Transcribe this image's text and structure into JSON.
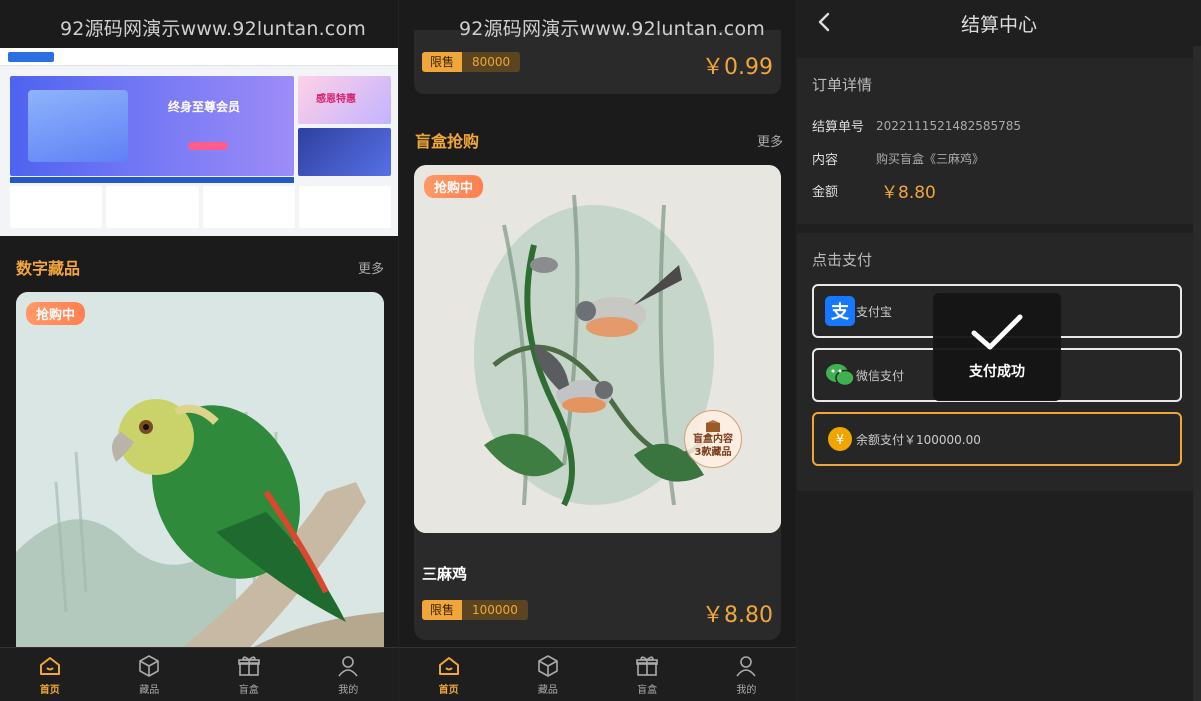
{
  "watermark": {
    "left": "92源码网演示www.92luntan.com",
    "middle": "92源码网演示www.92luntan.com"
  },
  "panel1": {
    "banner": {
      "hero_title": "终身至尊会员",
      "side_title": "感恩特惠"
    },
    "section": {
      "title": "数字藏品",
      "more": "更多"
    },
    "card": {
      "tag": "抢购中"
    }
  },
  "panel2": {
    "top_item": {
      "badge_label": "限售",
      "badge_count": "80000",
      "price": "￥0.99"
    },
    "section": {
      "title": "盲盒抢购",
      "more": "更多"
    },
    "box_item": {
      "tag": "抢购中",
      "seal_line1": "盲盒内容",
      "seal_line2": "3款藏品",
      "name": "三麻鸡",
      "badge_label": "限售",
      "badge_count": "100000",
      "price": "￥8.80"
    }
  },
  "tabs": [
    {
      "label": "首页",
      "icon": "home-icon",
      "active": true
    },
    {
      "label": "藏品",
      "icon": "cube-icon",
      "active": false
    },
    {
      "label": "盲盒",
      "icon": "gift-icon",
      "active": false
    },
    {
      "label": "我的",
      "icon": "user-icon",
      "active": false
    }
  ],
  "checkout": {
    "title": "结算中心",
    "order": {
      "heading": "订单详情",
      "number_label": "结算单号",
      "number_value": "2022111521482585785",
      "content_label": "内容",
      "content_value": "购买盲盒《三麻鸡》",
      "amount_label": "金额",
      "amount_value": "￥8.80"
    },
    "pay": {
      "heading": "点击支付",
      "alipay": "支付宝",
      "wechat": "微信支付",
      "balance": "余额支付￥100000.00"
    },
    "toast": "支付成功"
  },
  "colors": {
    "accent": "#f0a63a",
    "background": "#1b1b1b",
    "alipay": "#1677ff",
    "wechat": "#3fb24f"
  }
}
